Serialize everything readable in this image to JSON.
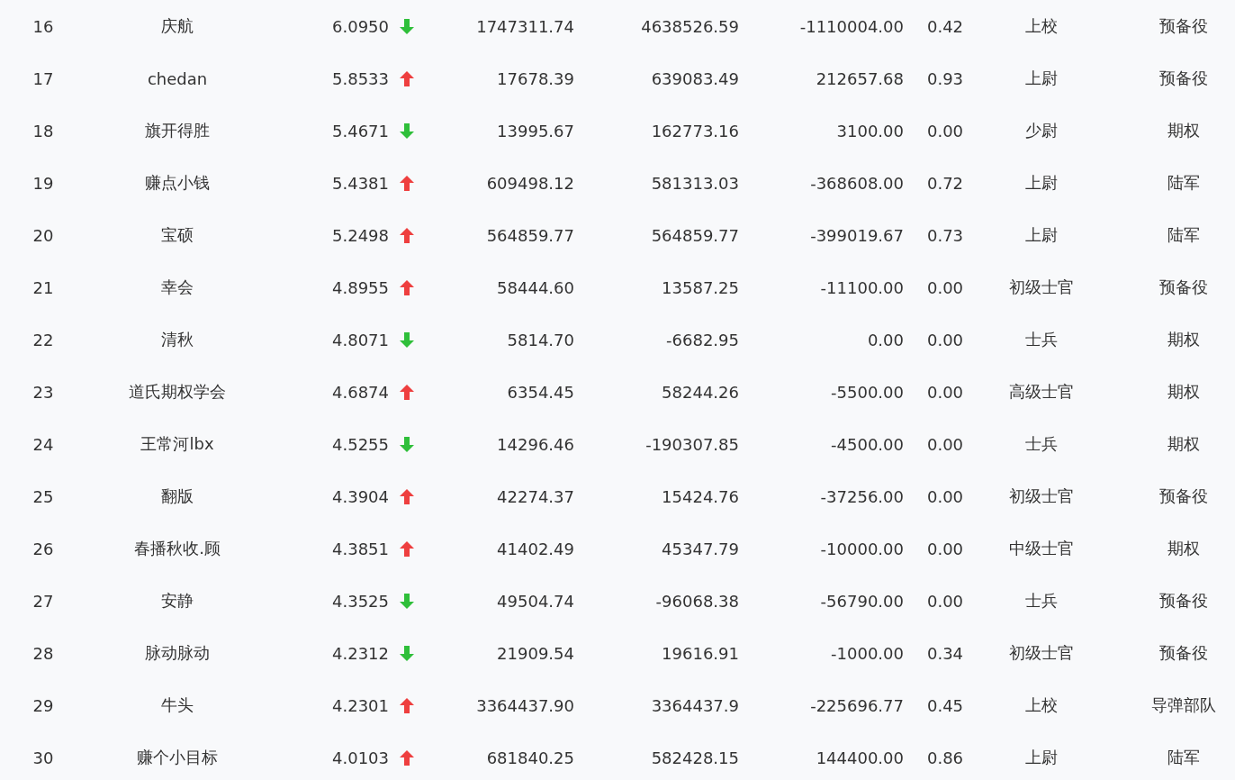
{
  "table": {
    "rows": [
      {
        "cells": [
          "16",
          "庆航",
          "6.0950",
          "1747311.74",
          "4638526.59",
          "-1110004.00",
          "0.42",
          "上校",
          "预备役"
        ],
        "rising": false
      },
      {
        "cells": [
          "17",
          "chedan",
          "5.8533",
          "17678.39",
          "639083.49",
          "212657.68",
          "0.93",
          "上尉",
          "预备役"
        ],
        "rising": true
      },
      {
        "cells": [
          "18",
          "旗开得胜",
          "5.4671",
          "13995.67",
          "162773.16",
          "3100.00",
          "0.00",
          "少尉",
          "期权"
        ],
        "rising": false
      },
      {
        "cells": [
          "19",
          "赚点小钱",
          "5.4381",
          "609498.12",
          "581313.03",
          "-368608.00",
          "0.72",
          "上尉",
          "陆军"
        ],
        "rising": true
      },
      {
        "cells": [
          "20",
          "宝硕",
          "5.2498",
          "564859.77",
          "564859.77",
          "-399019.67",
          "0.73",
          "上尉",
          "陆军"
        ],
        "rising": true
      },
      {
        "cells": [
          "21",
          "幸会",
          "4.8955",
          "58444.60",
          "13587.25",
          "-11100.00",
          "0.00",
          "初级士官",
          "预备役"
        ],
        "rising": true
      },
      {
        "cells": [
          "22",
          "清秋",
          "4.8071",
          "5814.70",
          "-6682.95",
          "0.00",
          "0.00",
          "士兵",
          "期权"
        ],
        "rising": false
      },
      {
        "cells": [
          "23",
          "道氏期权学会",
          "4.6874",
          "6354.45",
          "58244.26",
          "-5500.00",
          "0.00",
          "高级士官",
          "期权"
        ],
        "rising": true
      },
      {
        "cells": [
          "24",
          "王常河lbx",
          "4.5255",
          "14296.46",
          "-190307.85",
          "-4500.00",
          "0.00",
          "士兵",
          "期权"
        ],
        "rising": false
      },
      {
        "cells": [
          "25",
          "翻版",
          "4.3904",
          "42274.37",
          "15424.76",
          "-37256.00",
          "0.00",
          "初级士官",
          "预备役"
        ],
        "rising": true
      },
      {
        "cells": [
          "26",
          "春播秋收.顾",
          "4.3851",
          "41402.49",
          "45347.79",
          "-10000.00",
          "0.00",
          "中级士官",
          "期权"
        ],
        "rising": true
      },
      {
        "cells": [
          "27",
          "安静",
          "4.3525",
          "49504.74",
          "-96068.38",
          "-56790.00",
          "0.00",
          "士兵",
          "预备役"
        ],
        "rising": false
      },
      {
        "cells": [
          "28",
          "脉动脉动",
          "4.2312",
          "21909.54",
          "19616.91",
          "-1000.00",
          "0.34",
          "初级士官",
          "预备役"
        ],
        "rising": false
      },
      {
        "cells": [
          "29",
          "牛头",
          "4.2301",
          "3364437.90",
          "3364437.9",
          "-225696.77",
          "0.45",
          "上校",
          "导弹部队"
        ],
        "rising": true
      },
      {
        "cells": [
          "30",
          "赚个小目标",
          "4.0103",
          "681840.25",
          "582428.15",
          "144400.00",
          "0.86",
          "上尉",
          "陆军"
        ],
        "rising": true
      }
    ]
  }
}
